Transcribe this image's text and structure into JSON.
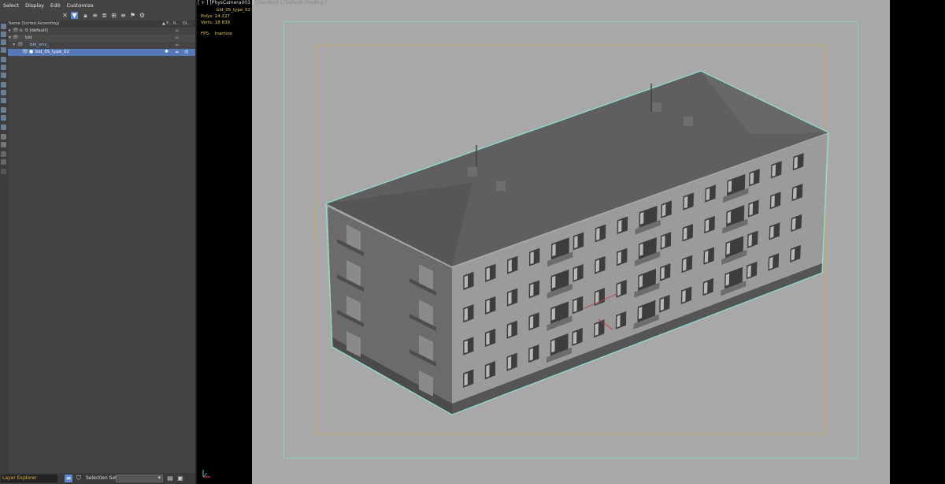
{
  "menu": {
    "items": [
      "Select",
      "Display",
      "Edit",
      "Customize"
    ]
  },
  "explorer": {
    "columns": {
      "name": "Name (Sorted Ascending)",
      "frozen": "▲ F...",
      "render": "R...",
      "display": "Di...",
      "other": "On..."
    },
    "rows": [
      {
        "label": "0 (default)"
      },
      {
        "label": "bld"
      },
      {
        "label": "bld_env_"
      },
      {
        "label": "bld_05_type_02"
      }
    ]
  },
  "bottom": {
    "explorer_name": "Layer Explorer",
    "selection_set_label": "Selection Set:"
  },
  "viewport": {
    "label_parts": [
      "[ + ]",
      "[PhysCamera003 ]",
      "[Standard ]",
      "[Default Shading ]"
    ],
    "object_name": "bld_05_type_02",
    "polys_label": "Polys:",
    "polys_value": "14 227",
    "verts_label": "Verts:",
    "verts_value": "18 839",
    "fps_label": "FPS:",
    "fps_value": "Inactive"
  },
  "colors": {
    "panel_bg": "#444444",
    "selection": "#5578b8",
    "viewport_bg": "#a8a8a8",
    "stats_text": "#e5c85a",
    "highlight_outline": "#8fe0d8"
  }
}
